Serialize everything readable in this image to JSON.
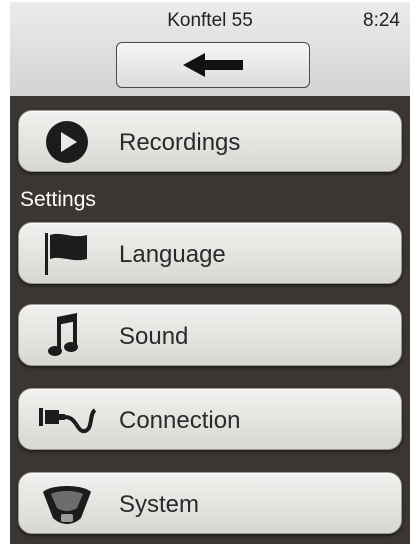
{
  "status_bar": {
    "title": "Konftel 55",
    "time": "8:24"
  },
  "header": {
    "back_icon": "arrow-left-icon"
  },
  "recordings": {
    "label": "Recordings",
    "icon": "play-icon"
  },
  "settings": {
    "section_label": "Settings",
    "items": [
      {
        "label": "Language",
        "icon": "flag-icon"
      },
      {
        "label": "Sound",
        "icon": "music-note-icon"
      },
      {
        "label": "Connection",
        "icon": "cable-plug-icon"
      },
      {
        "label": "System",
        "icon": "device-icon"
      }
    ]
  }
}
